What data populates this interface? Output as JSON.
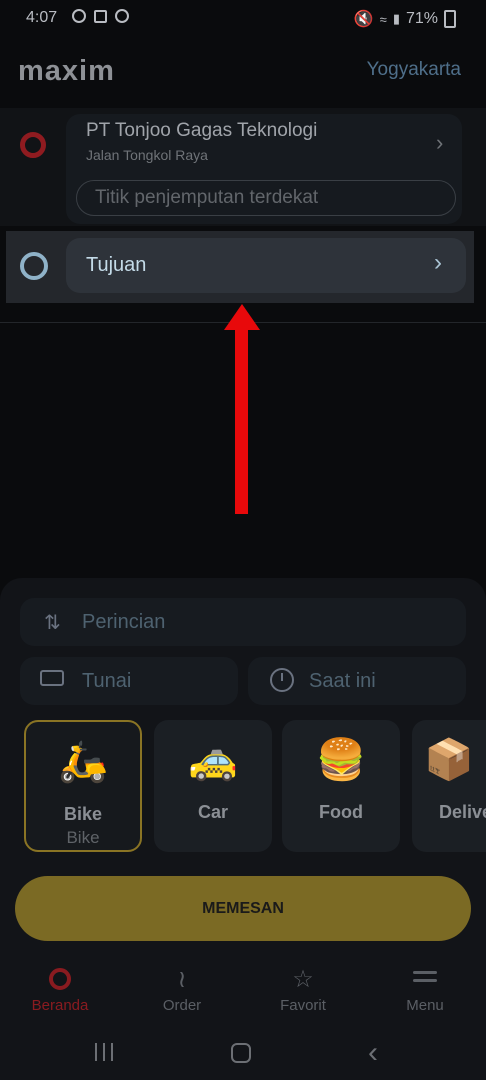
{
  "status_bar": {
    "time": "4:07",
    "battery": "71%",
    "icons_left": [
      "do-not-disturb-icon",
      "app-notification-icon",
      "sync-icon"
    ],
    "icons_right": [
      "mute-icon",
      "wifi-icon",
      "signal-icon",
      "battery-icon"
    ]
  },
  "header": {
    "logo": "maxim",
    "city": "Yogyakarta"
  },
  "route": {
    "pickup_title": "PT Tonjoo Gagas Teknologi",
    "pickup_subtitle": "Jalan Tongkol Raya",
    "pickup_placeholder": "Titik penjemputan terdekat",
    "destination_label": "Tujuan"
  },
  "options": {
    "details_label": "Perincian",
    "payment_label": "Tunai",
    "time_label": "Saat ini"
  },
  "services": [
    {
      "label": "Bike",
      "sublabel": "Bike",
      "selected": true,
      "icon": "scooter-icon"
    },
    {
      "label": "Car",
      "sublabel": "",
      "selected": false,
      "icon": "car-icon"
    },
    {
      "label": "Food",
      "sublabel": "",
      "selected": false,
      "icon": "food-icon"
    },
    {
      "label": "Delive",
      "sublabel": "",
      "selected": false,
      "icon": "courier-icon"
    }
  ],
  "order_button": "MEMESAN",
  "bottom_nav": [
    {
      "label": "Beranda",
      "icon": "home-icon",
      "active": true
    },
    {
      "label": "Order",
      "icon": "route-icon",
      "active": false
    },
    {
      "label": "Favorit",
      "icon": "star-icon",
      "active": false
    },
    {
      "label": "Menu",
      "icon": "menu-icon",
      "active": false
    }
  ],
  "colors": {
    "accent_red": "#8a1b20",
    "highlight_arrow": "#e8090b",
    "order_button": "#7b6a24",
    "selected_tile_border": "#8a7424"
  }
}
